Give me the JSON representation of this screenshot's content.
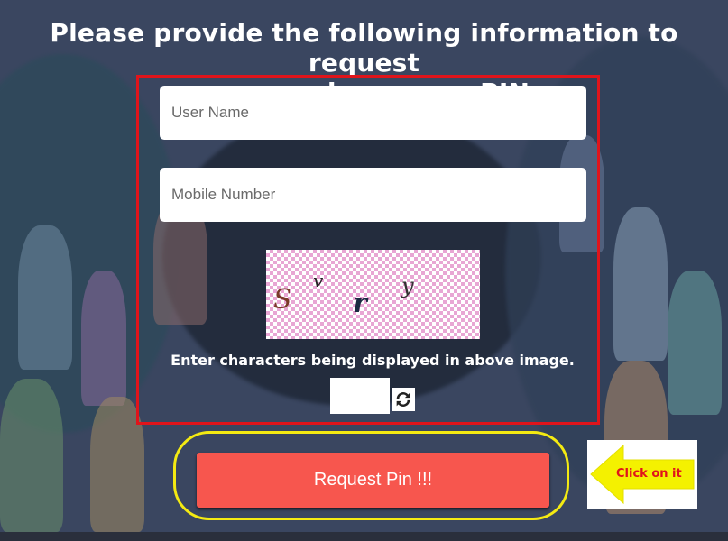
{
  "heading": {
    "line1": "Please provide the following information to request",
    "line2": "password recovery PIN"
  },
  "form": {
    "username_placeholder": "User Name",
    "mobile_placeholder": "Mobile Number",
    "captcha_chars": [
      "S",
      "v",
      "r",
      "y"
    ],
    "captcha_hint": "Enter characters being displayed in above image.",
    "captcha_input_value": "",
    "refresh_icon": "refresh-icon"
  },
  "actions": {
    "request_pin_label": "Request Pin !!!"
  },
  "callout": {
    "text": "Click on it",
    "icon": "arrow-left-icon"
  },
  "colors": {
    "form_border": "#e0141b",
    "highlight_border": "#f4ea12",
    "button_bg": "#f7564e",
    "arrow": "#f4f100"
  }
}
